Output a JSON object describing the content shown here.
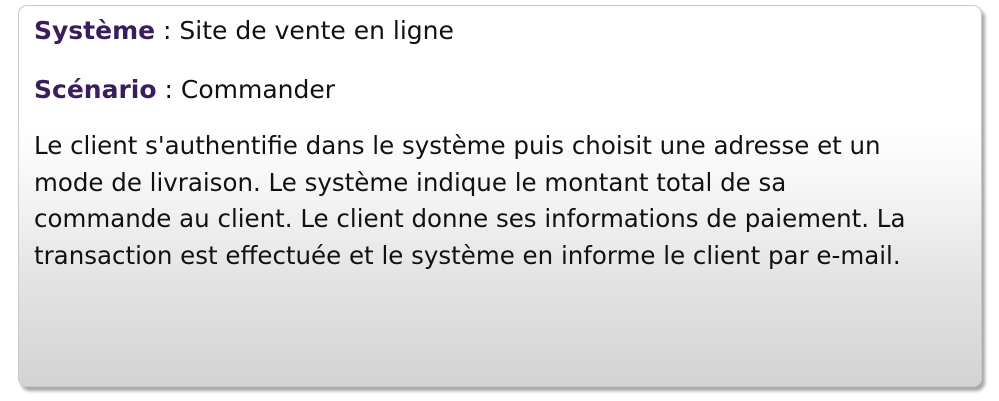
{
  "block": {
    "system": {
      "label": "Système",
      "separator": " : ",
      "value": "Site de vente en ligne"
    },
    "scenario": {
      "label": "Scénario",
      "separator": " : ",
      "value": "Commander"
    },
    "description_lines": [
      "Le client s'authentifie dans le système puis choisit une adresse et un",
      "mode de livraison. Le système indique le montant total de sa",
      "commande au client. Le client donne ses informations de paiement. La",
      "transaction est effectuée et le système en informe le client par e-mail."
    ]
  },
  "colors": {
    "label": "#3b1d5e",
    "text": "#111111"
  }
}
